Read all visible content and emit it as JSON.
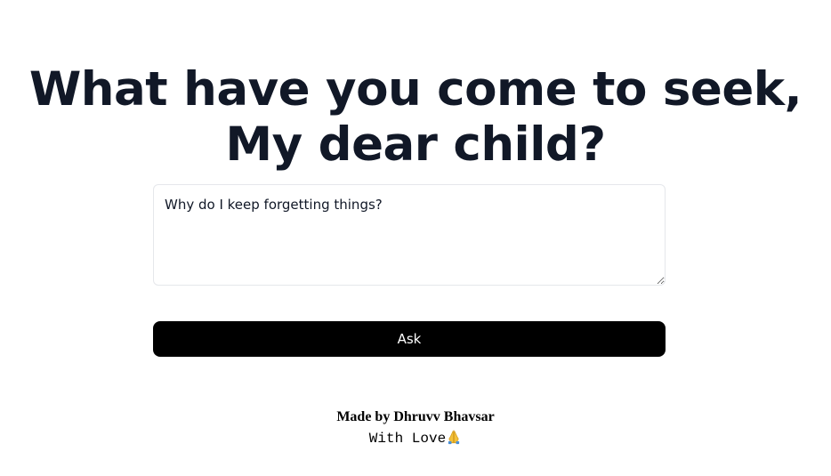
{
  "header": {
    "title_line1": "What have you come to seek,",
    "title_line2": "My dear child?"
  },
  "question": {
    "value": "Why do I keep forgetting things?"
  },
  "ask_button": {
    "label": "Ask"
  },
  "footer": {
    "made_by": "Made by Dhruvv Bhavsar",
    "with_love": "With Love",
    "love_icon": "folded-hands-icon"
  },
  "colors": {
    "title": "#111827",
    "button_bg": "#000000",
    "button_text": "#ffffff",
    "input_border": "#e5e7eb"
  }
}
